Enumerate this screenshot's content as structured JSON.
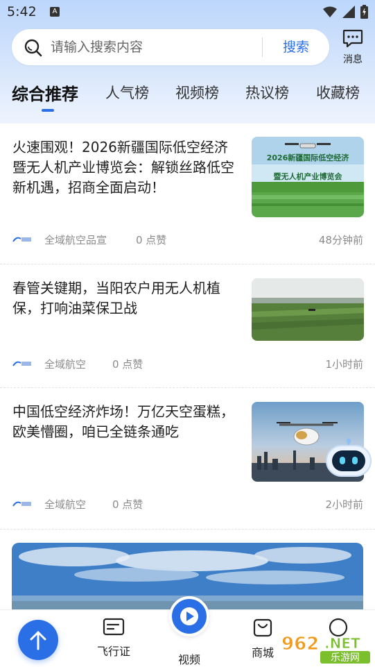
{
  "status_bar": {
    "time": "5:42",
    "notification_letter": "A"
  },
  "search": {
    "placeholder": "请输入搜索内容",
    "button_label": "搜索"
  },
  "message": {
    "label": "消息"
  },
  "tabs": [
    {
      "label": "综合推荐",
      "active": true
    },
    {
      "label": "人气榜"
    },
    {
      "label": "视频榜"
    },
    {
      "label": "热议榜"
    },
    {
      "label": "收藏榜"
    }
  ],
  "articles": [
    {
      "title": "火速围观！2026新疆国际低空经济暨无人机产业博览会：解锁丝路低空新机遇，招商全面启动！",
      "source": "全域航空品宣",
      "likes": "0 点赞",
      "time": "48分钟前",
      "thumb_text_1": "2026新疆国际低空经济",
      "thumb_text_2": "暨无人机产业博览会"
    },
    {
      "title": "春管关键期，当阳农户用无人机植保，打响油菜保卫战",
      "source": "全域航空",
      "likes": "0 点赞",
      "time": "1小时前"
    },
    {
      "title": "中国低空经济炸场！万亿天空蛋糕，欧美懵圈，咱已全链条通吃",
      "source": "全域航空",
      "likes": "0 点赞",
      "time": "2小时前"
    }
  ],
  "bottom_nav": [
    {
      "label": ""
    },
    {
      "label": "飞行证"
    },
    {
      "label": "视频"
    },
    {
      "label": "商城"
    },
    {
      "label": ""
    }
  ],
  "watermark": {
    "text_1": "962",
    "text_2": ".NET",
    "text_3": "乐游网"
  },
  "colors": {
    "accent": "#2b6fe7",
    "header_top": "#bcd6fb",
    "meta_gray": "#8a8a8a"
  }
}
